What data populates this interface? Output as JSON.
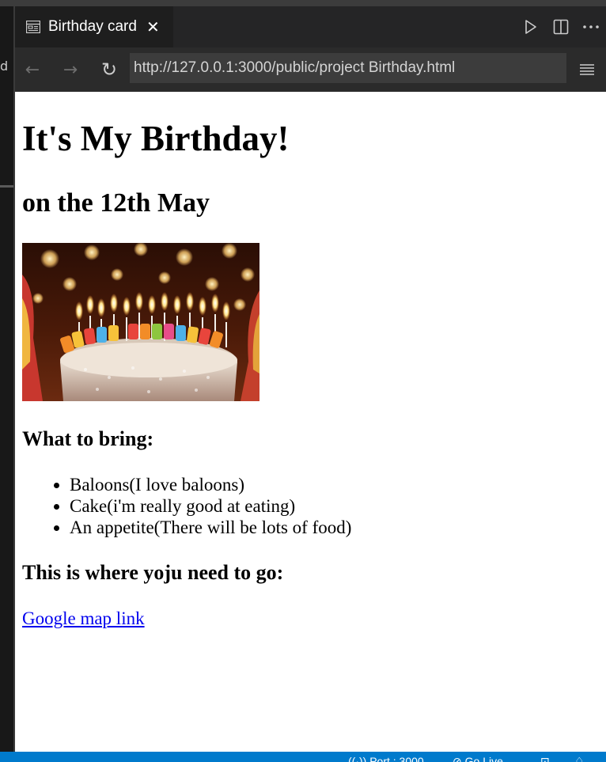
{
  "sidebar_fragment": "d",
  "tab": {
    "title": "Birthday card",
    "close_glyph": "✕",
    "icon": "preview-icon"
  },
  "tab_actions": [
    "run-icon",
    "split-editor-icon",
    "more-actions-icon"
  ],
  "nav": {
    "back": "←",
    "forward": "→",
    "reload": "↻",
    "menu": "≡"
  },
  "address_bar": {
    "value": "http://127.0.0.1:3000/public/project Birthday.html"
  },
  "page": {
    "title": "It's My Birthday!",
    "subtitle": "on the 12th May",
    "image": "birthday cake with happy birthday candles",
    "bring_heading": "What to bring:",
    "bring_items": [
      "Baloons(I love baloons)",
      "Cake(i'm really good at eating)",
      "An appetite(There will be lots of food)"
    ],
    "location_heading": "This is where yoju need to go:",
    "map_link": "Google map link"
  },
  "status_bar": {
    "port": "Port : 3000",
    "golive": "Go Live"
  },
  "colors": {
    "status_bar": "#007acc",
    "tab_bg": "#1e1e1e",
    "link": "#0000ee"
  }
}
